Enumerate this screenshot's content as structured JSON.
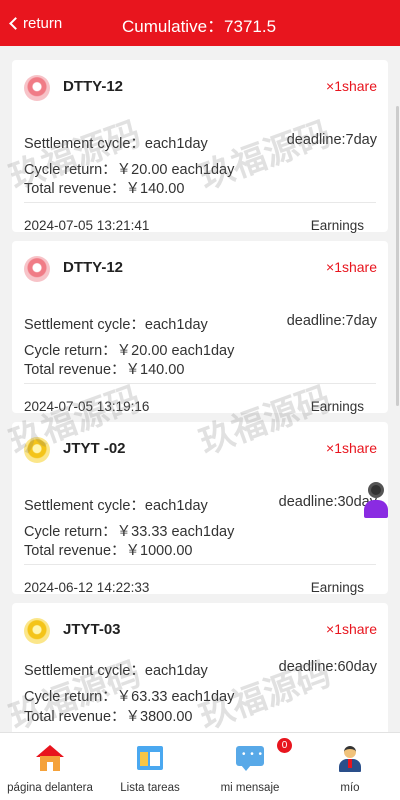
{
  "header": {
    "back_label": "return",
    "title": "Cumulative：7371.5"
  },
  "colors": {
    "brand": "#e8151e",
    "accent_text": "#e8151e"
  },
  "watermark": "玖福源码",
  "cards": [
    {
      "name": "DTTY-12",
      "icon": "red-badge-icon",
      "share": "×1share",
      "settlement": "Settlement cycle：each1day",
      "deadline": "deadline:7day",
      "cycle_return": "Cycle return：￥20.00 each1day",
      "total_revenue": "Total revenue：￥140.00",
      "date": "2024-07-05 13:21:41",
      "status": "Earnings"
    },
    {
      "name": "DTTY-12",
      "icon": "red-badge-icon",
      "share": "×1share",
      "settlement": "Settlement cycle：each1day",
      "deadline": "deadline:7day",
      "cycle_return": "Cycle return：￥20.00 each1day",
      "total_revenue": "Total revenue：￥140.00",
      "date": "2024-07-05 13:19:16",
      "status": "Earnings"
    },
    {
      "name": "JTYT -02",
      "icon": "gold-bulb-icon",
      "share": "×1share",
      "settlement": "Settlement cycle：each1day",
      "deadline": "deadline:30day",
      "cycle_return": "Cycle return：￥33.33 each1day",
      "total_revenue": "Total revenue：￥1000.00",
      "date": "2024-06-12 14:22:33",
      "status": "Earnings"
    },
    {
      "name": "JTYT-03",
      "icon": "gold-bulb-icon",
      "share": "×1share",
      "settlement": "Settlement cycle：each1day",
      "deadline": "deadline:60day",
      "cycle_return": "Cycle return：￥63.33 each1day",
      "total_revenue": "Total revenue：￥3800.00",
      "date": "",
      "status": ""
    }
  ],
  "tabbar": {
    "items": [
      {
        "label": "página delantera",
        "icon": "home-icon"
      },
      {
        "label": "Lista tareas",
        "icon": "task-list-icon"
      },
      {
        "label": "mi mensaje",
        "icon": "message-icon",
        "badge": "0"
      },
      {
        "label": "mío",
        "icon": "user-icon"
      }
    ]
  }
}
